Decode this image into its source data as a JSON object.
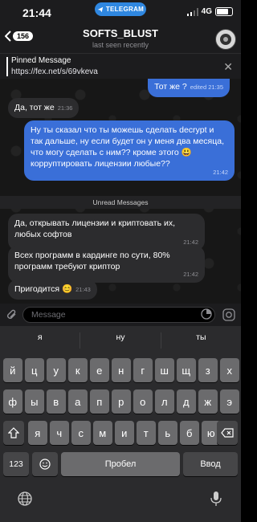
{
  "status": {
    "time": "21:44",
    "app_pill": "TELEGRAM",
    "network": "4G"
  },
  "header": {
    "back_count": "156",
    "title": "SOFTS_BLUST",
    "subtitle": "last seen recently"
  },
  "pinned": {
    "title": "Pinned Message",
    "link": "https://fex.net/s/69vkeva"
  },
  "messages": [
    {
      "dir": "out",
      "text": "Тот же ?",
      "time": "edited 21:35"
    },
    {
      "dir": "in",
      "text": "Да, тот же",
      "time": "21:36"
    },
    {
      "dir": "out",
      "text": "Ну ты сказал что ты можешь сделать decrypt и так дальше, ну если будет он  у меня два месяца, что могу сделать с ним?? кроме этого 😃 корруптировать лицензии любые??",
      "time": "21:42"
    },
    {
      "dir": "in",
      "text": "Да, открывать лицензии и криптовать их, любых софтов",
      "time": "21:42"
    },
    {
      "dir": "in",
      "text": "Всех программ в кардинге по сути, 80% программ требуют криптор",
      "time": "21:42"
    },
    {
      "dir": "in",
      "text": "Пригодится 😊",
      "time": "21:43"
    }
  ],
  "unread_label": "Unread Messages",
  "input": {
    "placeholder": "Message"
  },
  "suggestions": [
    "я",
    "ну",
    "ты"
  ],
  "keyboard": {
    "row1": [
      "й",
      "ц",
      "у",
      "к",
      "е",
      "н",
      "г",
      "ш",
      "щ",
      "з",
      "х"
    ],
    "row2": [
      "ф",
      "ы",
      "в",
      "а",
      "п",
      "р",
      "о",
      "л",
      "д",
      "ж",
      "э"
    ],
    "row3": [
      "я",
      "ч",
      "с",
      "м",
      "и",
      "т",
      "ь",
      "б",
      "ю"
    ],
    "numbers": "123",
    "space": "Пробел",
    "return": "Ввод"
  },
  "colors": {
    "outgoing_bubble": "#3a6fd8",
    "incoming_bubble": "#2c2c2e",
    "telegram_pill": "#2f87e0"
  }
}
